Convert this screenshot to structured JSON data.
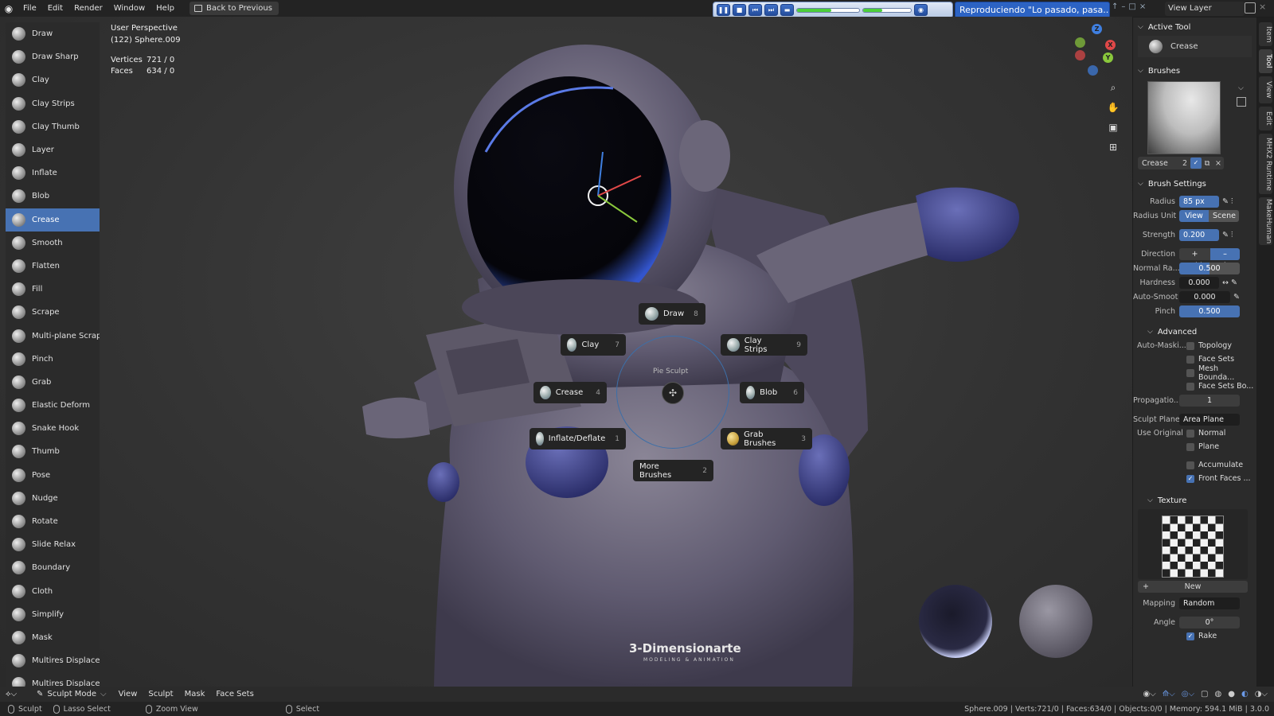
{
  "menu": {
    "items": [
      "File",
      "Edit",
      "Render",
      "Window",
      "Help"
    ],
    "back_label": "Back to Previous"
  },
  "media": {
    "title": "Reproduciendo \"Lo pasado, pasa...",
    "controls": [
      "↑",
      "–",
      "□",
      "×"
    ]
  },
  "view_layer": "View Layer",
  "viewport": {
    "perspective": "User Perspective",
    "object": "(122) Sphere.009",
    "vertices_label": "Vertices",
    "vertices_value": "721 / 0",
    "faces_label": "Faces",
    "faces_value": "634 / 0",
    "watermark_title": "3-Dimensionarte",
    "watermark_sub": "MODELING & ANIMATION"
  },
  "toolbar": {
    "tools": [
      {
        "label": "Draw"
      },
      {
        "label": "Draw Sharp"
      },
      {
        "label": "Clay"
      },
      {
        "label": "Clay Strips"
      },
      {
        "label": "Clay Thumb"
      },
      {
        "label": "Layer"
      },
      {
        "label": "Inflate"
      },
      {
        "label": "Blob"
      },
      {
        "label": "Crease"
      },
      {
        "label": "Smooth"
      },
      {
        "label": "Flatten"
      },
      {
        "label": "Fill"
      },
      {
        "label": "Scrape"
      },
      {
        "label": "Multi-plane Scrape"
      },
      {
        "label": "Pinch"
      },
      {
        "label": "Grab"
      },
      {
        "label": "Elastic Deform"
      },
      {
        "label": "Snake Hook"
      },
      {
        "label": "Thumb"
      },
      {
        "label": "Pose"
      },
      {
        "label": "Nudge"
      },
      {
        "label": "Rotate"
      },
      {
        "label": "Slide Relax"
      },
      {
        "label": "Boundary"
      },
      {
        "label": "Cloth"
      },
      {
        "label": "Simplify"
      },
      {
        "label": "Mask"
      },
      {
        "label": "Multires Displace..."
      },
      {
        "label": "Multires Displace..."
      }
    ],
    "active": "Crease"
  },
  "gizmo": {
    "x": "X",
    "y": "Y",
    "z": "Z"
  },
  "pie": {
    "title": "Pie Sculpt",
    "items": {
      "draw": {
        "label": "Draw",
        "num": "8"
      },
      "clay": {
        "label": "Clay",
        "num": "7"
      },
      "clay_strips": {
        "label": "Clay Strips",
        "num": "9"
      },
      "crease": {
        "label": "Crease",
        "num": "4"
      },
      "blob": {
        "label": "Blob",
        "num": "6"
      },
      "inflate": {
        "label": "Inflate/Deflate",
        "num": "1"
      },
      "grab": {
        "label": "Grab Brushes",
        "num": "3"
      },
      "more": {
        "label": "More Brushes",
        "num": "2"
      }
    }
  },
  "panel": {
    "active_tool_head": "Active Tool",
    "active_tool": "Crease",
    "brushes_head": "Brushes",
    "brush_name": "Crease",
    "brush_users": "2",
    "brush_settings_head": "Brush Settings",
    "radius_label": "Radius",
    "radius_value": "85 px",
    "radius_unit_label": "Radius Unit",
    "radius_unit_view": "View",
    "radius_unit_scene": "Scene",
    "strength_label": "Strength",
    "strength_value": "0.200",
    "direction_label": "Direction",
    "direction_add": "+ Add",
    "direction_sub": "– Sub...",
    "normal_radius_label": "Normal Ra...",
    "normal_radius_value": "0.500",
    "hardness_label": "Hardness",
    "hardness_value": "0.000",
    "autosmooth_label": "Auto-Smoot",
    "autosmooth_value": "0.000",
    "pinch_label": "Pinch",
    "pinch_value": "0.500",
    "advanced_head": "Advanced",
    "automask_label": "Auto-Maski...",
    "topology": "Topology",
    "face_sets": "Face Sets",
    "mesh_boundary": "Mesh Bounda...",
    "face_sets_boundary": "Face Sets Bo...",
    "propagation_label": "Propagatio...",
    "propagation_value": "1",
    "sculpt_plane_label": "Sculpt Plane",
    "sculpt_plane_value": "Area Plane",
    "use_original_label": "Use Original",
    "normal": "Normal",
    "plane": "Plane",
    "accumulate": "Accumulate",
    "front_faces": "Front Faces ...",
    "texture_head": "Texture",
    "texture_new": "New",
    "mapping_label": "Mapping",
    "mapping_value": "Random",
    "angle_label": "Angle",
    "angle_value": "0°",
    "rake": "Rake"
  },
  "side_tabs": [
    "Item",
    "Tool",
    "View",
    "Edit",
    "MHX2 Runtime",
    "MakeHuman"
  ],
  "header": {
    "mode": "Sculpt Mode",
    "menus": [
      "View",
      "Sculpt",
      "Mask",
      "Face Sets"
    ]
  },
  "status": {
    "sculpt": "Sculpt",
    "lasso": "Lasso Select",
    "zoom": "Zoom View",
    "select": "Select",
    "info": "Sphere.009 | Verts:721/0 | Faces:634/0 | Objects:0/0 | Memory: 594.1 MiB | 3.0.0"
  },
  "colors": {
    "accent": "#4772b3",
    "panel": "#2b2b2b",
    "media_bar": "#2c63c4",
    "gizmo_x": "#e04848",
    "gizmo_y": "#8ac83c",
    "gizmo_z": "#3f7fe0"
  }
}
